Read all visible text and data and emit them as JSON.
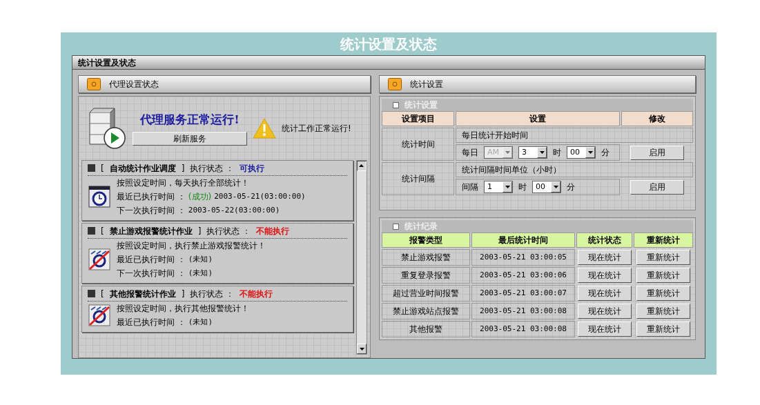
{
  "page_title": "统计设置及状态",
  "window": {
    "title": "统计设置及状态"
  },
  "left_panel": {
    "title": "代理设置状态",
    "service_status": "代理服务正常运行!",
    "refresh_button": "刷新服务",
    "work_status": "统计工作正常运行!",
    "jobs": [
      {
        "bracket_left": "[",
        "name": "自动统计作业调度",
        "bracket_right": "]",
        "status_label": "执行状态 ：",
        "status": "可执行",
        "status_ok": true,
        "kind": "clock",
        "description": "按照设定时间，每天执行全部统计！",
        "last_run": {
          "label": "最近已执行时间 ：",
          "result": "(成功)",
          "value": "2003-05-21(03:00:00)"
        },
        "next_run": {
          "label": "下一次执行时间 ：",
          "value": "2003-05-22(03:00:00)"
        }
      },
      {
        "bracket_left": "[",
        "name": "禁止游戏报警统计作业",
        "bracket_right": "]",
        "status_label": "执行状态 ：",
        "status": "不能执行",
        "status_ok": false,
        "kind": "forbidden",
        "description": "按照设定时间，执行禁止游戏报警统计！",
        "last_run": {
          "label": "最近已执行时间 ：",
          "value": "(未知)"
        },
        "next_run": {
          "label": "下一次执行时间 ：",
          "value": "(未知)"
        }
      },
      {
        "bracket_left": "[",
        "name": "其他报警统计作业",
        "bracket_right": "]",
        "status_label": "执行状态 ：",
        "status": "不能执行",
        "status_ok": false,
        "kind": "forbidden",
        "description": "按照设定时间，执行其他报警统计！",
        "last_run": {
          "label": "最近已执行时间 ：",
          "value": "(未知)"
        }
      }
    ]
  },
  "right_panel": {
    "title": "统计设置",
    "settings": {
      "title": "统计设置",
      "columns": [
        "设置项目",
        "设置",
        "修改"
      ],
      "rows": [
        {
          "item": "统计时间",
          "caption": "每日统计开始时间",
          "button": "启用",
          "controls": [
            {
              "kind": "text",
              "text": "每日"
            },
            {
              "kind": "select",
              "value": "AM",
              "disabled": true
            },
            {
              "kind": "select",
              "value": "3",
              "disabled": false
            },
            {
              "kind": "text",
              "text": "时"
            },
            {
              "kind": "select",
              "value": "00",
              "disabled": false
            },
            {
              "kind": "text",
              "text": "分"
            }
          ]
        },
        {
          "item": "统计间隔",
          "caption": "统计间隔时间单位（小时）",
          "button": "启用",
          "controls": [
            {
              "kind": "text",
              "text": "间隔"
            },
            {
              "kind": "select",
              "value": "1",
              "disabled": false
            },
            {
              "kind": "text",
              "text": "时"
            },
            {
              "kind": "select",
              "value": "00",
              "disabled": false
            },
            {
              "kind": "text",
              "text": "分"
            }
          ]
        }
      ]
    },
    "records": {
      "title": "统计纪录",
      "columns": [
        "报警类型",
        "最后统计时间",
        "统计状态",
        "重新统计"
      ],
      "rows": [
        {
          "type": "禁止游戏报警",
          "time": "2003-05-21 03:00:05",
          "now_button": "现在统计",
          "redo_button": "重新统计"
        },
        {
          "type": "重复登录报警",
          "time": "2003-05-21 03:00:06",
          "now_button": "现在统计",
          "redo_button": "重新统计"
        },
        {
          "type": "超过营业时间报警",
          "time": "2003-05-21 03:00:07",
          "now_button": "现在统计",
          "redo_button": "重新统计"
        },
        {
          "type": "禁止游戏站点报警",
          "time": "2003-05-21 03:00:08",
          "now_button": "现在统计",
          "redo_button": "重新统计"
        },
        {
          "type": "其他报警",
          "time": "2003-05-21 03:00:08",
          "now_button": "现在统计",
          "redo_button": "重新统计"
        }
      ]
    }
  }
}
